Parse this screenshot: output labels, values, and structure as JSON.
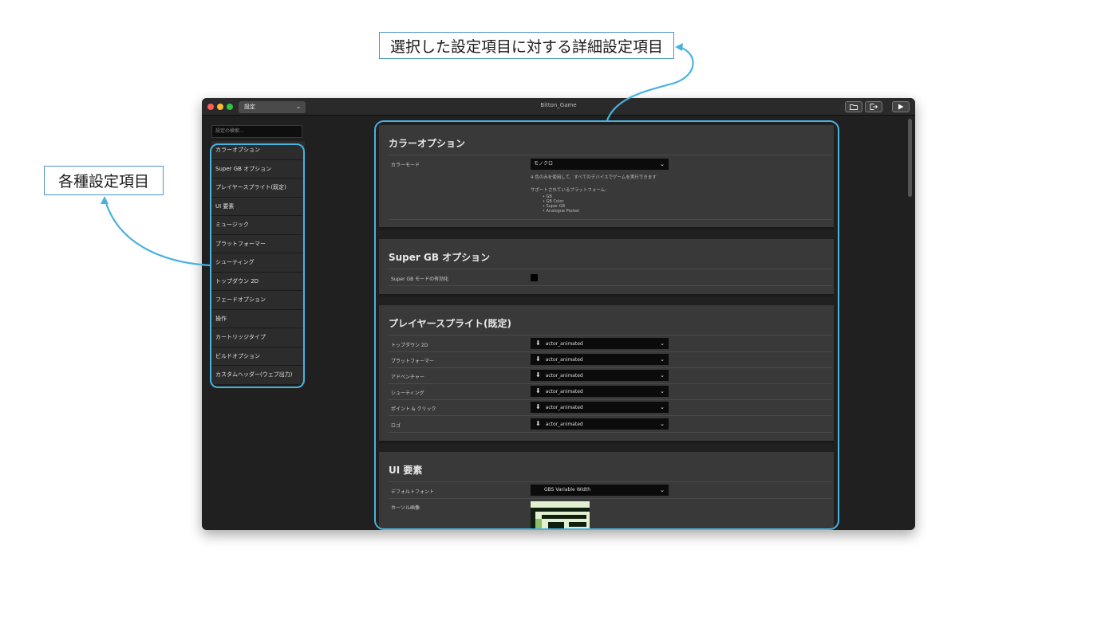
{
  "annotations": {
    "top_label": "選択した設定項目に対する詳細設定項目",
    "left_label": "各種設定項目"
  },
  "window": {
    "title": "Bitton_Game",
    "section_select": "設定",
    "toolbar_icons": [
      "folder-icon",
      "export-icon",
      "play-icon"
    ]
  },
  "sidebar": {
    "search_placeholder": "設定の検索...",
    "items": [
      {
        "label": "カラーオプション"
      },
      {
        "label": "Super GB オプション"
      },
      {
        "label": "プレイヤースプライト(既定)"
      },
      {
        "label": "UI 要素"
      },
      {
        "label": "ミュージック"
      },
      {
        "label": "プラットフォーマー"
      },
      {
        "label": "シューティング"
      },
      {
        "label": "トップダウン 2D"
      },
      {
        "label": "フェードオプション"
      },
      {
        "label": "操作"
      },
      {
        "label": "カートリッジタイプ"
      },
      {
        "label": "ビルドオプション"
      },
      {
        "label": "カスタムヘッダー(ウェブ出力)"
      }
    ]
  },
  "color_options": {
    "title": "カラーオプション",
    "mode_label": "カラーモード",
    "mode_value": "モノクロ",
    "description": "4 色のみを使用して、すべてのデバイスでゲームを実行できます",
    "supported_label": "サポートされているプラットフォーム:",
    "platforms": [
      "GB",
      "GB Color",
      "Super GB",
      "Analogue Pocket"
    ]
  },
  "super_gb": {
    "title": "Super GB オプション",
    "enable_label": "Super GB モードの有効化",
    "enabled": true
  },
  "player_sprites": {
    "title": "プレイヤースプライト(既定)",
    "rows": [
      {
        "label": "トップダウン 2D",
        "value": "actor_animated"
      },
      {
        "label": "プラットフォーマー",
        "value": "actor_animated"
      },
      {
        "label": "アドベンチャー",
        "value": "actor_animated"
      },
      {
        "label": "シューティング",
        "value": "actor_animated"
      },
      {
        "label": "ポイント & クリック",
        "value": "actor_animated"
      },
      {
        "label": "ロゴ",
        "value": "actor_animated"
      }
    ]
  },
  "ui_elements": {
    "title": "UI 要素",
    "font_label": "デフォルトフォント",
    "font_value": "GBS Variable Width",
    "cursor_label": "カーソル画像"
  },
  "colors": {
    "highlight": "#49b2e0",
    "panel": "#393939",
    "background": "#202020",
    "cursor_bg": "#e3f0cf"
  }
}
